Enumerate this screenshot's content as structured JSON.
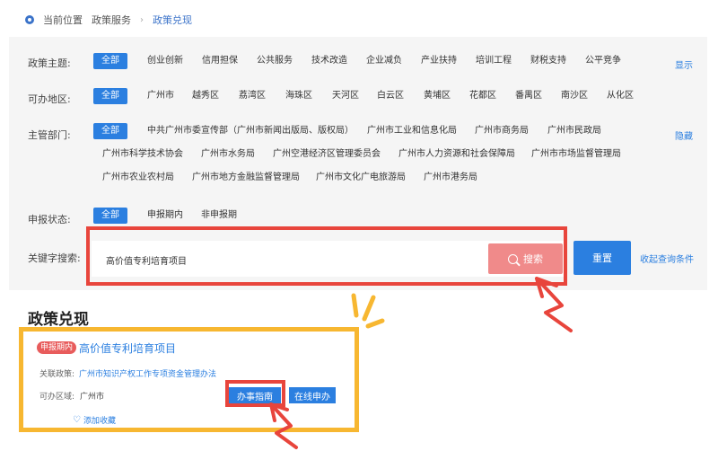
{
  "breadcrumb": {
    "items": [
      "当前位置",
      "政策服务",
      "政策兑现"
    ]
  },
  "filters": {
    "theme": {
      "label": "政策主题:",
      "options": [
        "全部",
        "创业创新",
        "信用担保",
        "公共服务",
        "技术改造",
        "企业减负",
        "产业扶持",
        "培训工程",
        "财税支持",
        "公平竞争"
      ],
      "toggle": "显示"
    },
    "region": {
      "label": "可办地区:",
      "options": [
        "全部",
        "广州市",
        "越秀区",
        "荔湾区",
        "海珠区",
        "天河区",
        "白云区",
        "黄埔区",
        "花都区",
        "番禺区",
        "南沙区",
        "从化区"
      ]
    },
    "department": {
      "label": "主管部门:",
      "options": [
        "全部",
        "中共广州市委宣传部（广州市新闻出版局、版权局）",
        "广州市工业和信息化局",
        "广州市商务局",
        "广州市民政局",
        "广州市科学技术协会",
        "广州市水务局",
        "广州空港经济区管理委员会",
        "广州市人力资源和社会保障局",
        "广州市市场监督管理局",
        "广州市农业农村局",
        "广州市地方金融监督管理局",
        "广州市文化广电旅游局",
        "广州市港务局"
      ],
      "toggle": "隐藏"
    },
    "status": {
      "label": "申报状态:",
      "options": [
        "全部",
        "申报期内",
        "非申报期"
      ]
    }
  },
  "search": {
    "label": "关键字搜索:",
    "value": "高价值专利培育项目",
    "button": "搜索",
    "reset": "重置",
    "collapse": "收起查询条件"
  },
  "results": {
    "title": "政策兑现",
    "card": {
      "badge": "申报期内",
      "title": "高价值专利培育项目",
      "policy_label": "关联政策:",
      "policy_value": "广州市知识产权工作专项资金管理办法",
      "region_label": "可办区域:",
      "region_value": "广州市",
      "guide_button": "办事指南",
      "apply_button": "在线申办",
      "favorite": "添加收藏"
    }
  },
  "colors": {
    "accent": "#2b7fe0",
    "highlight_red": "#e8453c",
    "highlight_yellow": "#f7b731",
    "search_button": "#f08a8a"
  }
}
